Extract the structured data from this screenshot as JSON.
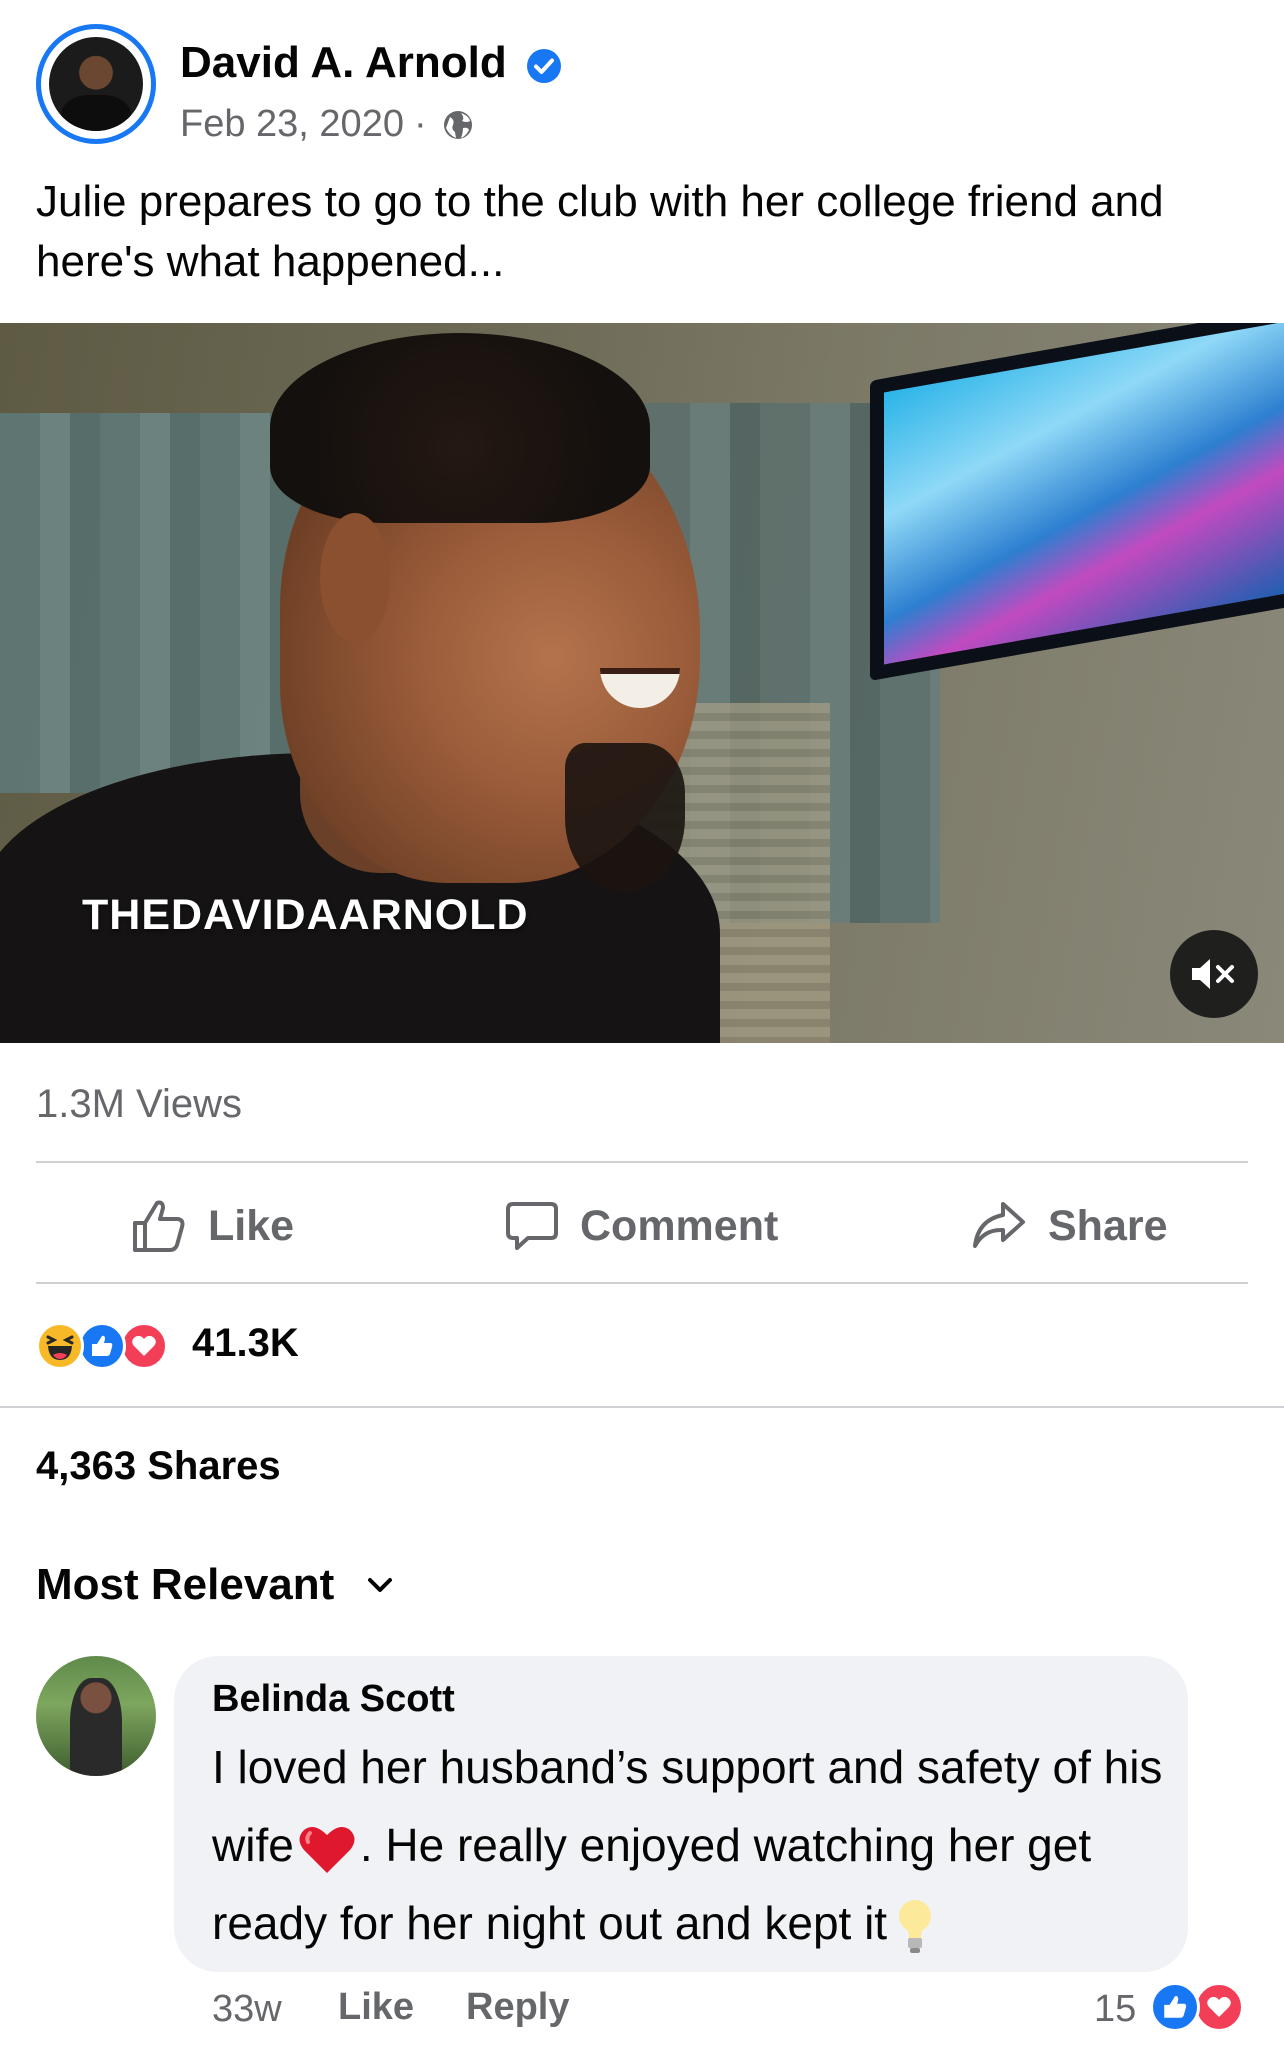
{
  "post": {
    "author": "David A. Arnold",
    "date": "Feb 23, 2020",
    "separator": "·",
    "caption": "Julie prepares to go to the club with her college friend and here's what happened..."
  },
  "video": {
    "watermark": "THEDAVIDAARNOLD"
  },
  "stats": {
    "views": "1.3M Views",
    "reaction_count": "41.3K",
    "shares": "4,363 Shares",
    "reactions": [
      "haha-icon",
      "like-icon",
      "love-icon"
    ]
  },
  "actions": {
    "like": "Like",
    "comment": "Comment",
    "share": "Share"
  },
  "comments": {
    "sort_label": "Most Relevant",
    "items": [
      {
        "author": "Belinda Scott",
        "text_part1": "I loved her husband’s support and safety of his wife",
        "text_part2": ".  He really enjoyed watching her get ready for her night out and kept it",
        "time": "33w",
        "like_label": "Like",
        "reply_label": "Reply",
        "reaction_count": "15"
      }
    ]
  },
  "colors": {
    "accent": "#1877f2",
    "secondary_text": "#65676b",
    "bubble": "#f0f2f5",
    "love": "#f33e58",
    "haha": "#f7b928"
  }
}
